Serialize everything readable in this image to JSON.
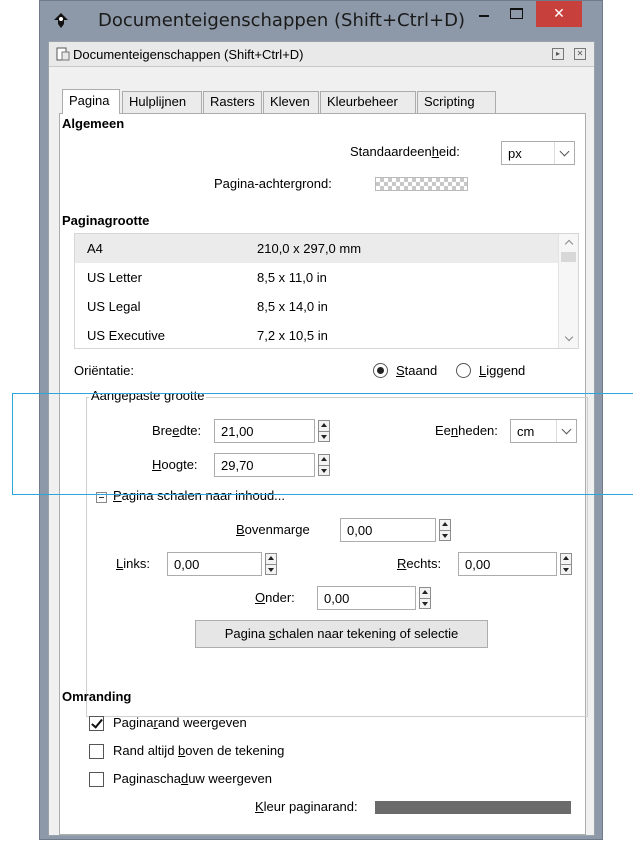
{
  "window": {
    "title": "Documenteigenschappen (Shift+Ctrl+D)",
    "close_glyph": "✕",
    "accent_close": "#c7403c"
  },
  "dock": {
    "title": "Documenteigenschappen (Shift+Ctrl+D)",
    "pin_glyph": "▸",
    "close_glyph": "✕"
  },
  "tabs": [
    {
      "label": "Pagina",
      "active": true
    },
    {
      "label": "Hulplijnen"
    },
    {
      "label": "Rasters"
    },
    {
      "label": "Kleven"
    },
    {
      "label": "Kleurbeheer"
    },
    {
      "label": "Scripting"
    }
  ],
  "general": {
    "heading": "Algemeen",
    "unit_label_pre": "Standaardeen",
    "unit_label_ul": "h",
    "unit_label_post": "eid:",
    "unit_value": "px",
    "bg_label": "Pagina-achtergrond:"
  },
  "pagesize": {
    "heading": "Paginagrootte",
    "rows": [
      {
        "name": "A4",
        "size": "210,0 x 297,0 mm"
      },
      {
        "name": "US Letter",
        "size": "8,5 x 11,0 in"
      },
      {
        "name": "US Legal",
        "size": "8,5 x 14,0 in"
      },
      {
        "name": "US Executive",
        "size": "7,2 x 10,5 in"
      }
    ],
    "orientation_label": "Oriëntatie:",
    "portrait_ul": "S",
    "portrait_rest": "taand",
    "landscape_ul": "L",
    "landscape_rest": "iggend"
  },
  "custom": {
    "legend": "Aangepaste grootte",
    "width_pre": "Bre",
    "width_ul": "e",
    "width_post": "dte:",
    "width_value": "21,00",
    "height_ul": "H",
    "height_post": "oogte:",
    "height_value": "29,70",
    "units_pre": "Ee",
    "units_ul": "n",
    "units_post": "heden:",
    "units_value": "cm"
  },
  "scale": {
    "toggle_ul": "P",
    "toggle_rest": "agina schalen naar inhoud...",
    "top_ul": "B",
    "top_rest": "ovenmarge",
    "top_value": "0,00",
    "left_ul": "L",
    "left_rest": "inks:",
    "left_value": "0,00",
    "right_ul": "R",
    "right_rest": "echts:",
    "right_value": "0,00",
    "bottom_ul": "O",
    "bottom_rest": "nder:",
    "bottom_value": "0,00",
    "button_pre": "Pagina ",
    "button_ul": "s",
    "button_post": "chalen naar tekening of selectie"
  },
  "border": {
    "heading": "Omranding",
    "show_pre": "Pagina",
    "show_ul": "r",
    "show_post": "and weergeven",
    "show_checked": true,
    "ontop_pre": "Rand altijd ",
    "ontop_ul": "b",
    "ontop_post": "oven de tekening",
    "shadow_pre": "Paginascha",
    "shadow_ul": "d",
    "shadow_post": "uw weergeven",
    "color_ul": "K",
    "color_rest": "leur paginarand:",
    "border_color": "#6b6b6b"
  }
}
